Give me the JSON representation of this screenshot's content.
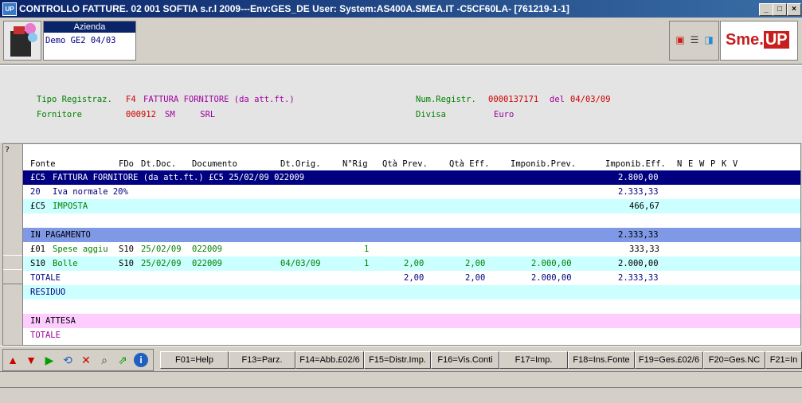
{
  "window": {
    "app_icon": "UP",
    "title": "CONTROLLO FATTURE. 02 001 SOFTIA s.r.l     2009---Env:GES_DE User:          System:AS400A.SMEA.IT -C5CF60LA- [761219-1-1]",
    "min": "_",
    "max": "□",
    "close": "×"
  },
  "azienda": {
    "label": "Azienda",
    "value": "Demo GE2 04/03"
  },
  "logo": {
    "text_a": "Sme.",
    "text_b": "UP"
  },
  "info": {
    "tipo_label": "Tipo Registraz.",
    "tipo_code": "F4",
    "tipo_desc": "FATTURA FORNITORE (da att.ft.)",
    "fornitore_label": "Fornitore",
    "fornitore_code": "000912",
    "fornitore_name": "SM     SRL",
    "numreg_label": "Num.Registr.",
    "numreg_value": "0000137171",
    "del_label": "del",
    "del_value": "04/03/09",
    "divisa_label": "Divisa",
    "divisa_value": "Euro"
  },
  "grid": {
    "corner": "?",
    "columns": [
      "Fonte",
      "FDo",
      "Dt.Doc.",
      "Documento",
      "Dt.Orig.",
      "N°Rig",
      "Qtà Prev.",
      "Qtà Eff.",
      "Imponib.Prev.",
      "Imponib.Eff.",
      "N",
      "E",
      "W",
      "P",
      "K",
      "V"
    ],
    "rows": [
      {
        "fonte": "£C5",
        "desc": "FATTURA FORNITORE (da att.ft.) £C5 25/02/09 022009",
        "eff": "2.800,00"
      },
      {
        "fonte": "20",
        "desc": "Iva normale 20%",
        "eff": "2.333,33"
      },
      {
        "fonte": "£C5",
        "desc": "IMPOSTA",
        "eff": "466,67"
      },
      {
        "fonte": "",
        "desc": "",
        "eff": ""
      },
      {
        "fonte": "IN PAGAMENTO",
        "desc": "",
        "eff": "2.333,33"
      },
      {
        "fonte": "£01",
        "desc": "Spese aggiu",
        "fdo": "S10",
        "dtdoc": "25/02/09",
        "doc": "022009",
        "nrig": "1",
        "eff": "333,33"
      },
      {
        "fonte": "S10",
        "desc": "Bolle",
        "fdo": "S10",
        "dtdoc": "25/02/09",
        "doc": "022009",
        "dtorig": "04/03/09",
        "nrig": "1",
        "qprev": "2,00",
        "qeff": "2,00",
        "iprev": "2.000,00",
        "eff": "2.000,00"
      },
      {
        "fonte": "TOTALE",
        "qprev": "2,00",
        "qeff": "2,00",
        "iprev": "2.000,00",
        "eff": "2.333,33"
      },
      {
        "fonte": "RESIDUO"
      },
      {
        "fonte": ""
      },
      {
        "fonte": "IN ATTESA"
      },
      {
        "fonte": "TOTALE"
      }
    ]
  },
  "nav": {
    "up": "▲",
    "down": "▼",
    "play": "▶",
    "refresh": "⟲",
    "delete": "✕",
    "search": "⌕",
    "export": "⇗",
    "info": "i"
  },
  "fkeys": [
    "F01=Help",
    "F13=Parz.",
    "F14=Abb.£02/6",
    "F15=Distr.Imp.",
    "F16=Vis.Conti",
    "F17=Imp.",
    "F18=Ins.Fonte",
    "F19=Ges.£02/6",
    "F20=Ges.NC",
    "F21=In"
  ],
  "colors": {
    "selected_row": "#000080",
    "cyan": "#ccffff",
    "blue_band": "#7f99e6",
    "pink": "#ffccff",
    "title": "#0a246a"
  }
}
